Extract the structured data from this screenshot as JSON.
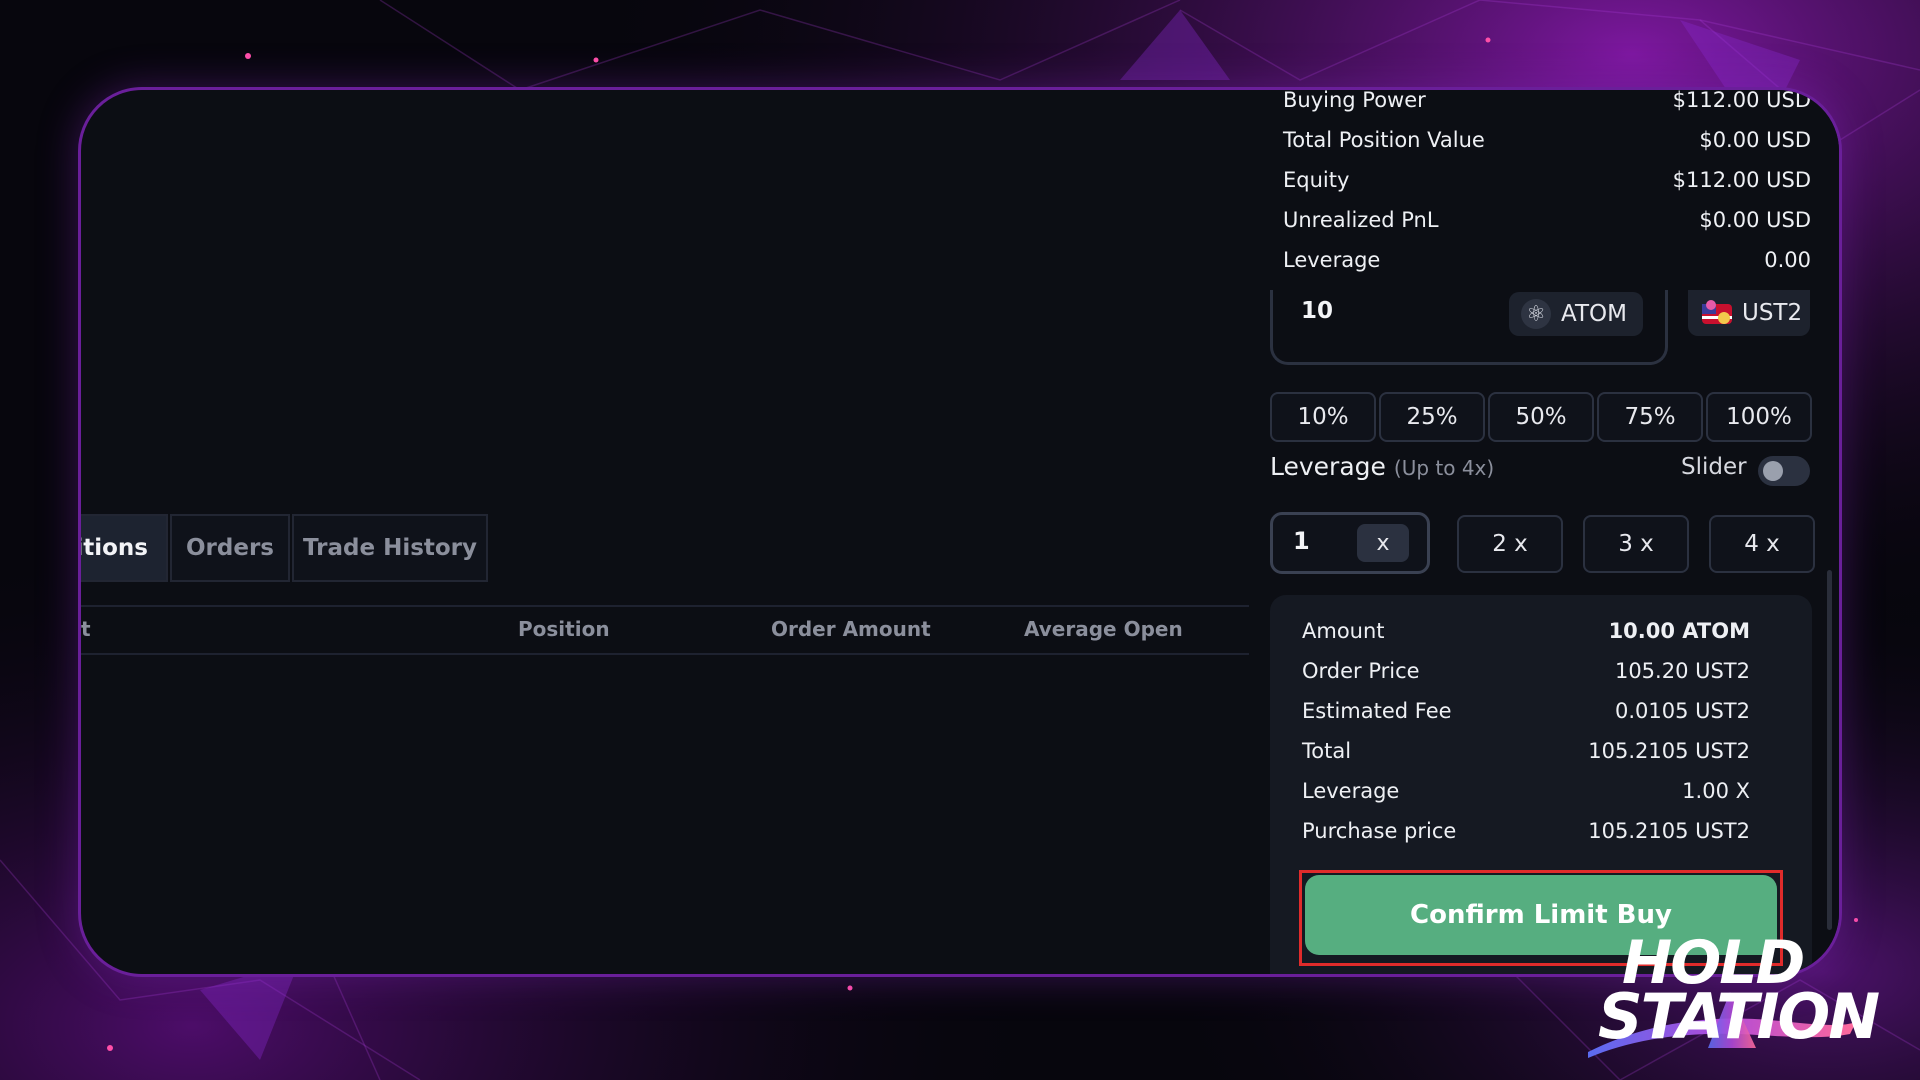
{
  "colors": {
    "accent_purple": "#6a1f9a",
    "confirm_green": "#56ae80",
    "highlight_red": "#e02b2b",
    "panel_bg": "#0c0e14"
  },
  "tabs": [
    {
      "label": "sitions"
    },
    {
      "label": "Orders"
    },
    {
      "label": "Trade History"
    }
  ],
  "table": {
    "col_partial": "t",
    "columns": [
      "Position",
      "Order Amount",
      "Average Open"
    ]
  },
  "account_summary": [
    {
      "label": "Buying Power",
      "value": "$112.00 USD"
    },
    {
      "label": "Total Position Value",
      "value": "$0.00 USD"
    },
    {
      "label": "Equity",
      "value": "$112.00 USD"
    },
    {
      "label": "Unrealized PnL",
      "value": "$0.00 USD"
    },
    {
      "label": "Leverage",
      "value": "0.00"
    }
  ],
  "amount_input": {
    "value": "10",
    "token": "ATOM",
    "token_icon": "cosmos-atom-icon"
  },
  "quote_token": {
    "label": "UST2",
    "icon": "ust2-token-icon"
  },
  "percent_buttons": [
    "10%",
    "25%",
    "50%",
    "75%",
    "100%"
  ],
  "leverage": {
    "title": "Leverage",
    "subtitle": "(Up to 4x)",
    "slider_label": "Slider",
    "slider_enabled": false,
    "input_value": "1",
    "input_suffix": "x",
    "options": [
      "2 x",
      "3 x",
      "4 x"
    ]
  },
  "order_summary": [
    {
      "label": "Amount",
      "value": "10.00 ATOM"
    },
    {
      "label": "Order Price",
      "value": "105.20 UST2"
    },
    {
      "label": "Estimated Fee",
      "value": "0.0105 UST2"
    },
    {
      "label": "Total",
      "value": "105.2105 UST2"
    },
    {
      "label": "Leverage",
      "value": "1.00 X"
    },
    {
      "label": "Purchase price",
      "value": "105.2105 UST2"
    }
  ],
  "confirm_button": {
    "label": "Confirm Limit Buy"
  },
  "logo": {
    "line1": "HOLD",
    "line2": "STATION"
  }
}
